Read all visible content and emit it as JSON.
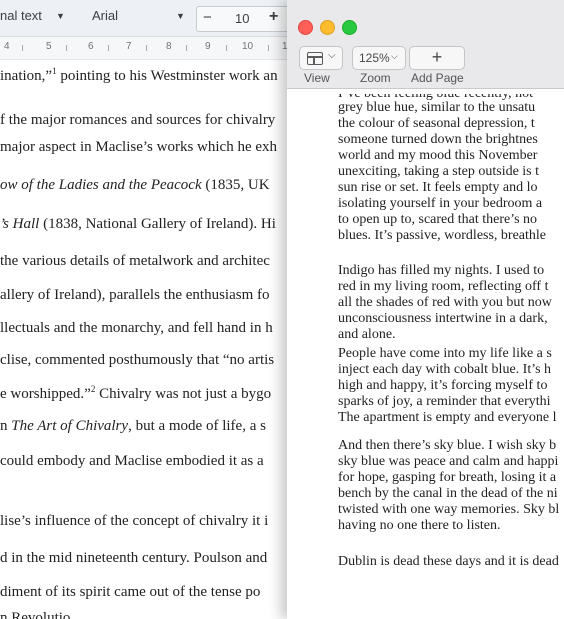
{
  "docs": {
    "toolbar": {
      "style": "nal text",
      "font": "Arial",
      "size_minus": "−",
      "font_size": "10",
      "size_plus": "+"
    },
    "ruler": [
      "4",
      "5",
      "6",
      "7",
      "8",
      "9",
      "10",
      "1"
    ],
    "lines": [
      {
        "pre": "ination,”",
        "sup": "1",
        "post": " pointing to his Westminster work an"
      },
      {
        "text": "f the major romances and sources for chivalry"
      },
      {
        "text": "major aspect in Maclise’s works which he exh"
      },
      {
        "it": "ow of the Ladies and the Peacock",
        "post": " (1835, UK"
      },
      {
        "it": "’s Hall",
        "post": " (1838, National Gallery of Ireland). Hi"
      },
      {
        "text": " the various details of metalwork and architec"
      },
      {
        "text": "allery of Ireland), parallels the enthusiasm fo"
      },
      {
        "text": "llectuals and the monarchy, and fell hand in h"
      },
      {
        "text": "clise, commented posthumously that “no artis"
      },
      {
        "pre": "e worshipped.”",
        "sup": "2",
        "post": " Chivalry was not just a bygo"
      },
      {
        "pre": "n ",
        "it": "The Art of Chivalry",
        "post": ", but a mode of life, a s"
      },
      {
        "text": " could embody and Maclise embodied it as a"
      },
      {
        "text": "lise’s influence of the concept of chivalry it i"
      },
      {
        "text": "d in the mid nineteenth century. Poulson and"
      },
      {
        "text": "diment of its spirit came out of the tense po"
      },
      {
        "text": "n Revolutio"
      }
    ]
  },
  "pages": {
    "toolbar": {
      "view_label": "View",
      "zoom_value": "125%",
      "zoom_chevron": "⌵",
      "zoom_label": "Zoom",
      "add_page_glyph": "+",
      "add_page_label": "Add Page"
    },
    "lines": [
      "I’ve been feeling blue recently, not",
      "grey blue hue, similar to the unsatu",
      "the colour of seasonal depression, t",
      "someone turned down the brightnes",
      "world and my mood this November",
      "unexciting, taking a step outside is t",
      "sun rise or set. It feels empty and lo",
      "isolating yourself in your bedroom a",
      "to open up to, scared that there’s no",
      "blues. It’s passive, wordless, breathle",
      "Indigo has filled my nights. I used to",
      "red in my living room, reflecting off t",
      "all the shades of red with you but now",
      "unconsciousness intertwine in a dark,",
      "and alone.",
      "People have come into my life like a s",
      "inject each day with cobalt blue. It’s h",
      "high and happy, it’s forcing myself to",
      "sparks of joy, a reminder that everythi",
      "The apartment is empty and everyone l",
      "And then there’s sky blue. I wish sky b",
      "sky blue was peace and calm and happi",
      "for hope, gasping for breath, losing it a",
      "bench by the canal in the dead of the ni",
      "twisted with one way memories. Sky bl",
      "having no one there to listen.",
      "Dublin is dead these days and it is dead"
    ]
  }
}
